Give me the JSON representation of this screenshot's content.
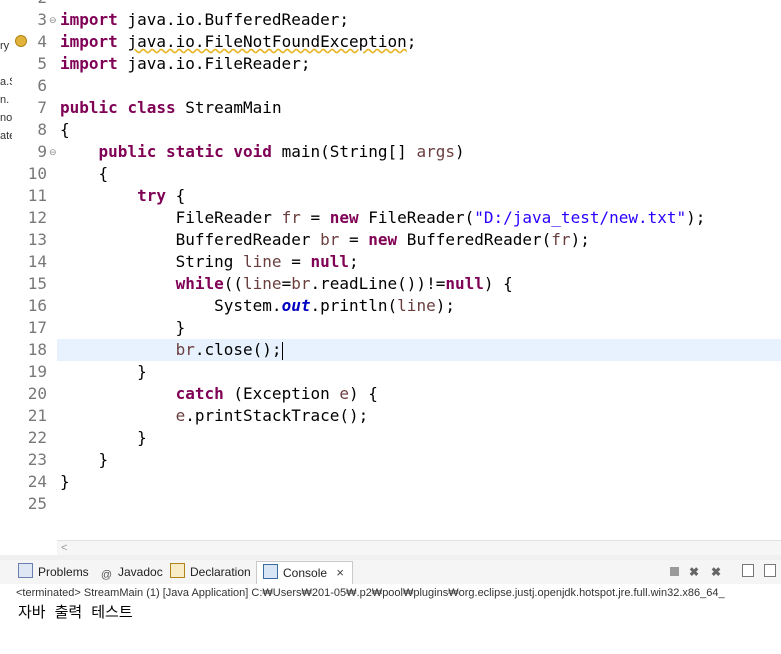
{
  "left_strip_fragments": [
    "ry",
    "a.S",
    "n.",
    "no",
    "ate"
  ],
  "line_numbers": [
    "2",
    "3",
    "4",
    "5",
    "6",
    "7",
    "8",
    "9",
    "10",
    "11",
    "12",
    "13",
    "14",
    "15",
    "16",
    "17",
    "18",
    "19",
    "20",
    "21",
    "22",
    "23",
    "24",
    "25"
  ],
  "fold_markers": [
    "⊖",
    "⊖"
  ],
  "code": {
    "l3": {
      "kw": "import",
      "rest": " java.io.BufferedReader;"
    },
    "l4": {
      "kw": "import",
      "rest_pre": " ",
      "rest_wavy": "java.io.FileNotFoundException",
      "rest_post": ";"
    },
    "l5": {
      "kw": "import",
      "rest": " java.io.FileReader;"
    },
    "l7": {
      "kw1": "public",
      "kw2": "class",
      "rest": " StreamMain"
    },
    "l8": {
      "text": "{"
    },
    "l9": {
      "kw1": "public",
      "kw2": "static",
      "kw3": "void",
      "rest": " main(String[] ",
      "var": "args",
      "end": ")"
    },
    "l10": {
      "text": "{"
    },
    "l11": {
      "kw": "try",
      "rest": " {"
    },
    "l12": {
      "pre": "FileReader ",
      "var": "fr",
      "mid": " = ",
      "kw": "new",
      "post": " FileReader(",
      "str": "\"D:/java_test/new.txt\"",
      "end": ");"
    },
    "l13": {
      "pre": "BufferedReader ",
      "var": "br",
      "mid": " = ",
      "kw": "new",
      "post": " BufferedReader(",
      "var2": "fr",
      "end": ");"
    },
    "l14": {
      "pre": "String ",
      "var": "line",
      "mid": " = ",
      "kw": "null",
      "end": ";"
    },
    "l15": {
      "kw": "while",
      "p1": "((",
      "var1": "line",
      "p2": "=",
      "var2": "br",
      "p3": ".readLine())!=",
      "kw2": "null",
      "end": ") {"
    },
    "l16": {
      "pre": "System.",
      "fld": "out",
      "post": ".println(",
      "var": "line",
      "end": ");"
    },
    "l17": {
      "text": "}"
    },
    "l18": {
      "var": "br",
      "end": ".close();"
    },
    "l19": {
      "text": "}"
    },
    "l20": {
      "kw": "catch",
      "pre": " (Exception ",
      "var": "e",
      "end": ") {"
    },
    "l21": {
      "var": "e",
      "end": ".printStackTrace();"
    },
    "l22": {
      "text": "}"
    },
    "l23": {
      "text": "}"
    },
    "l24": {
      "text": "}"
    }
  },
  "hscroll_arrow": "<",
  "tabs": {
    "problems": "Problems",
    "javadoc": "Javadoc",
    "declaration": "Declaration",
    "console": "Console",
    "console_close": "×"
  },
  "status_line": "<terminated> StreamMain (1) [Java Application] C:₩Users₩201-05₩.p2₩pool₩plugins₩org.eclipse.justj.openjdk.hotspot.jre.full.win32.x86_64_",
  "console_output": "자바 출력 테스트",
  "colors": {
    "keyword": "#7f0055",
    "string": "#2a00ff",
    "variable": "#6a3e3e",
    "field": "#0000c0",
    "current_line": "#e8f2fe"
  }
}
